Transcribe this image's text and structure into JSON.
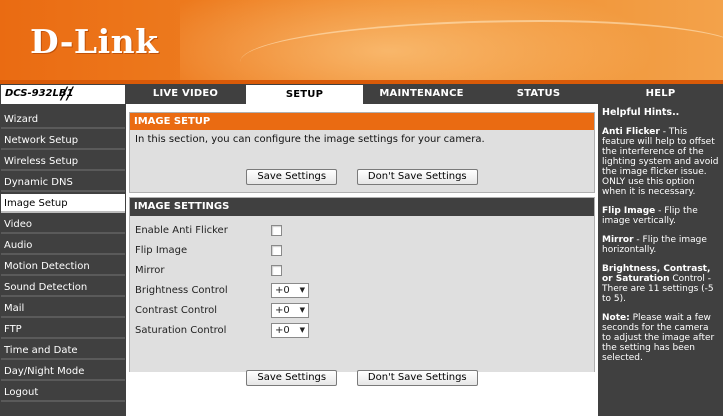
{
  "header": {
    "logo_text": "D-Link"
  },
  "model": {
    "name": "DCS-932LB1",
    "slashes": "//"
  },
  "nav": {
    "tabs": [
      {
        "label": "LIVE VIDEO",
        "active": false
      },
      {
        "label": "SETUP",
        "active": true
      },
      {
        "label": "MAINTENANCE",
        "active": false
      },
      {
        "label": "STATUS",
        "active": false
      },
      {
        "label": "HELP",
        "active": false
      }
    ]
  },
  "sidebar": {
    "items": [
      {
        "label": "Wizard"
      },
      {
        "label": "Network Setup"
      },
      {
        "label": "Wireless Setup"
      },
      {
        "label": "Dynamic DNS"
      },
      {
        "label": "Image Setup",
        "active": true
      },
      {
        "label": "Video"
      },
      {
        "label": "Audio"
      },
      {
        "label": "Motion Detection"
      },
      {
        "label": "Sound Detection"
      },
      {
        "label": "Mail"
      },
      {
        "label": "FTP"
      },
      {
        "label": "Time and Date"
      },
      {
        "label": "Day/Night Mode"
      },
      {
        "label": "Logout"
      }
    ]
  },
  "image_setup": {
    "title": "IMAGE SETUP",
    "intro": "In this section, you can configure the image settings for your camera.",
    "save_label": "Save Settings",
    "dont_save_label": "Don't Save Settings"
  },
  "image_settings": {
    "title": "IMAGE SETTINGS",
    "anti_flicker_label": "Enable Anti Flicker",
    "anti_flicker_checked": false,
    "flip_label": "Flip Image",
    "flip_checked": false,
    "mirror_label": "Mirror",
    "mirror_checked": false,
    "brightness_label": "Brightness Control",
    "brightness_value": "+0",
    "contrast_label": "Contrast Control",
    "contrast_value": "+0",
    "saturation_label": "Saturation Control",
    "saturation_value": "+0"
  },
  "footer_buttons": {
    "save_label": "Save Settings",
    "dont_save_label": "Don't Save Settings"
  },
  "help": {
    "title": "Helpful Hints..",
    "hints": [
      {
        "term": "Anti Flicker",
        "text": " - This feature will help to offset the interference of the lighting system and avoid the image flicker issue. ONLY use this option when it is necessary."
      },
      {
        "term": "Flip Image",
        "text": " - Flip the image vertically."
      },
      {
        "term": "Mirror",
        "text": " - Flip the image horizontally."
      },
      {
        "term": "Brightness, Contrast, or Saturation",
        "text": " Control - There are 11 settings (-5 to 5)."
      },
      {
        "term": "Note:",
        "text": " Please wait a few seconds for the camera to adjust the image after the setting has been selected."
      }
    ]
  },
  "colors": {
    "brand_orange": "#ea6b12",
    "dark_gray": "#404040",
    "panel_gray": "#dfdfdf"
  },
  "icons": {
    "checkbox": "checkbox-icon",
    "dropdown": "chevron-down-icon"
  }
}
